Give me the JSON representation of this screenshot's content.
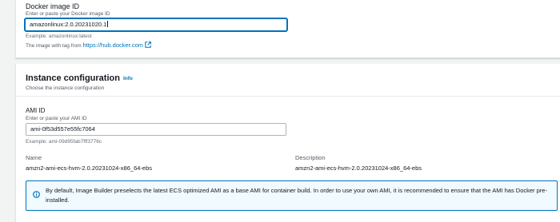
{
  "docker_section": {
    "image_id_label": "Docker image ID",
    "image_id_description": "Enter or paste your Docker image ID",
    "image_id_value": "amazonlinux:2.0.20231020.1",
    "image_id_example": "Example: amazonlinux:latest",
    "image_tag_prefix": "The image with tag from",
    "image_tag_link": "https://hub.docker.com"
  },
  "instance_configuration": {
    "title": "Instance configuration",
    "info_label": "Info",
    "subtitle": "Choose the instance configuration",
    "ami_id_label": "AMI ID",
    "ami_id_description": "Enter or paste your AMI ID",
    "ami_id_value": "ami-0f53d557e55fc7064",
    "ami_id_example": "Example: ami-09d95fab7fff3776c",
    "name_label": "Name",
    "name_value": "amzn2-ami-ecs-hvm-2.0.20231024-x86_64-ebs",
    "description_label": "Description",
    "description_value": "amzn2-ami-ecs-hvm-2.0.20231024-x86_64-ebs",
    "alert_text": "By default, Image Builder preselects the latest ECS optimized AMI as a base AMI for container build. In order to use your own AMI, it is recommended to ensure that the AMI has Docker pre-installed."
  },
  "icons": {
    "external_link": "external-link-icon",
    "info_alert": "info-circle-icon"
  },
  "colors": {
    "link": "#0073bb",
    "focus_border": "#0073bb",
    "alert_background": "#f1faff",
    "alert_border": "#0073bb",
    "page_background": "#f2f3f3"
  }
}
